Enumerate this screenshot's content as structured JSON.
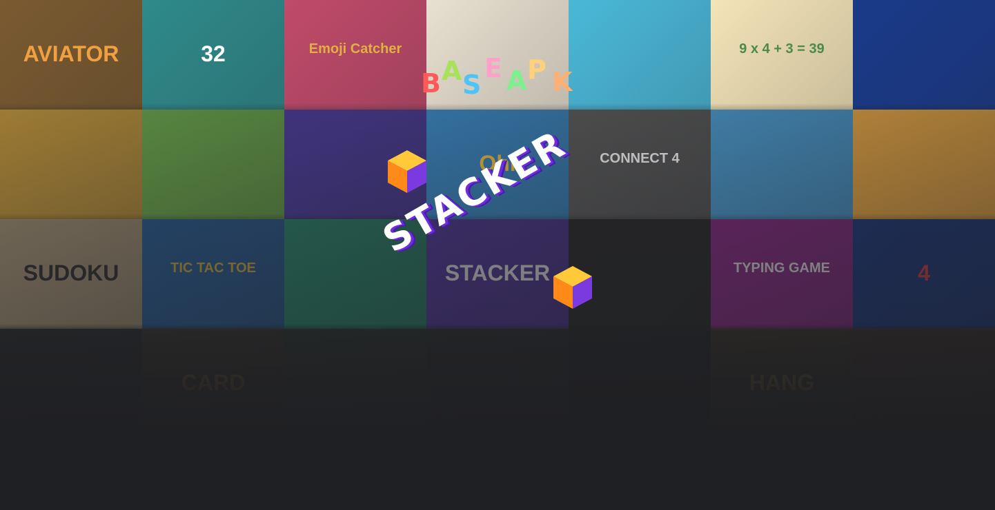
{
  "logo": {
    "letters": [
      "B",
      "A",
      "S",
      "E",
      "A",
      "P",
      "K"
    ],
    "colors": [
      "#ff5a5a",
      "#a6e35a",
      "#4fc3f7",
      "#ffa0c8",
      "#7cf08a",
      "#ffd27a",
      "#ffb070"
    ]
  },
  "splash": {
    "title": "STACKER"
  },
  "tiles": [
    {
      "label": "AVIATOR",
      "bg": "#7a5a30",
      "fg": "#f0a040"
    },
    {
      "label": "32",
      "bg": "#2f8a8a",
      "fg": "#ffffff"
    },
    {
      "label": "Emoji Catcher",
      "bg": "#c04a6a",
      "fg": "#e0b040"
    },
    {
      "label": "",
      "bg": "#e8e0d0",
      "fg": "#333333"
    },
    {
      "label": "",
      "bg": "#4ab8d8",
      "fg": "#ffffff"
    },
    {
      "label": "9 x 4 + 3 = 39",
      "bg": "#f4e4b8",
      "fg": "#4a8a4a"
    },
    {
      "label": "",
      "bg": "#1a3a8a",
      "fg": "#ffffff"
    },
    {
      "label": "",
      "bg": "#c89a3a",
      "fg": "#333333"
    },
    {
      "label": "",
      "bg": "#6aa84a",
      "fg": "#333333"
    },
    {
      "label": "",
      "bg": "#4a3a9a",
      "fg": "#ffffff"
    },
    {
      "label": "Ohi",
      "bg": "#3a8ac8",
      "fg": "#f0c040"
    },
    {
      "label": "CONNECT 4",
      "bg": "#5a5a5a",
      "fg": "#ffffff"
    },
    {
      "label": "",
      "bg": "#4a9ad0",
      "fg": "#ffffff"
    },
    {
      "label": "",
      "bg": "#e0a040",
      "fg": "#333333"
    },
    {
      "label": "SUDOKU",
      "bg": "#d0b890",
      "fg": "#333333"
    },
    {
      "label": "TIC TAC TOE",
      "bg": "#2a6ab0",
      "fg": "#f0c040"
    },
    {
      "label": "",
      "bg": "#2a9a7a",
      "fg": "#1a4a4a"
    },
    {
      "label": "STACKER",
      "bg": "#5a3ab0",
      "fg": "#ffffff"
    },
    {
      "label": "",
      "bg": "#2a2a2a",
      "fg": "#ffffff"
    },
    {
      "label": "TYPING GAME",
      "bg": "#a02a9a",
      "fg": "#ffffff"
    },
    {
      "label": "4",
      "bg": "#1a3a8a",
      "fg": "#e04040"
    },
    {
      "label": "",
      "bg": "#3a3a3a",
      "fg": "#ffffff"
    },
    {
      "label": "CARD",
      "bg": "#5a4a3a",
      "fg": "#f0a040"
    },
    {
      "label": "",
      "bg": "#3a4a3a",
      "fg": "#ffffff"
    },
    {
      "label": "",
      "bg": "#3a3a3a",
      "fg": "#ffffff"
    },
    {
      "label": "",
      "bg": "#2a2a2a",
      "fg": "#ffffff"
    },
    {
      "label": "HANG",
      "bg": "#5a4a30",
      "fg": "#f0c040"
    },
    {
      "label": "",
      "bg": "#5a3a30",
      "fg": "#ffffff"
    }
  ]
}
